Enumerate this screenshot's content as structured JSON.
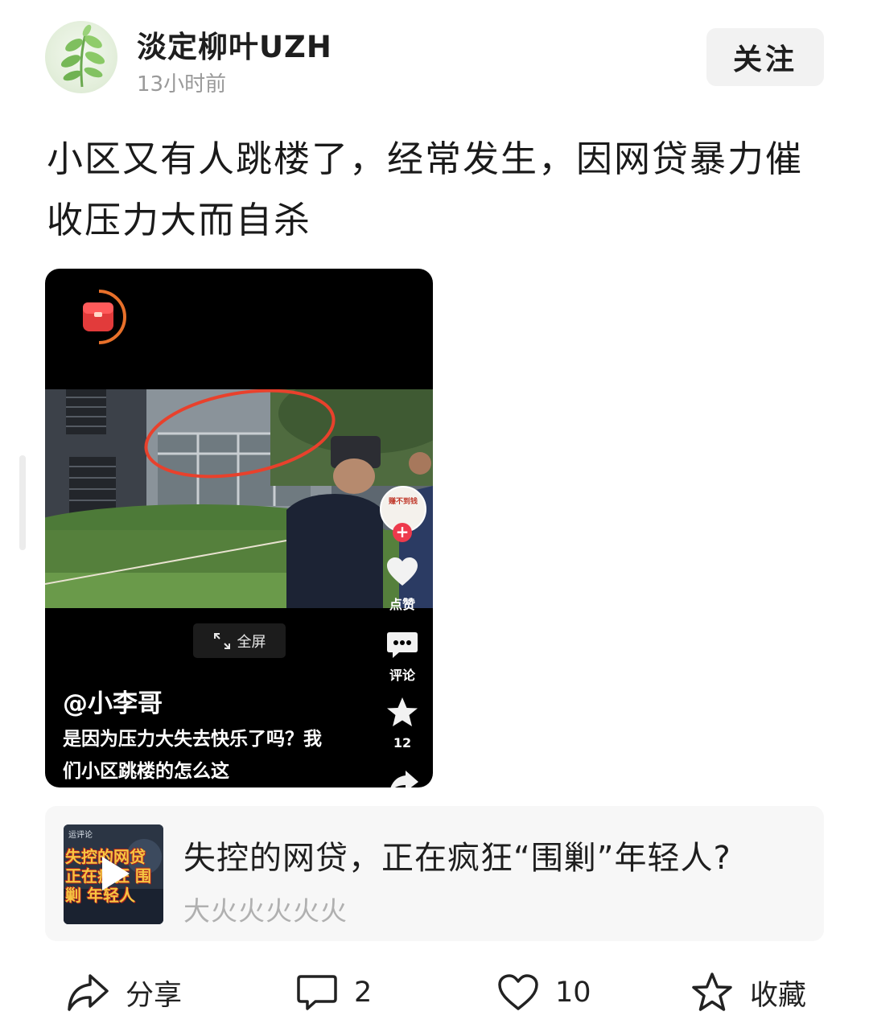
{
  "post": {
    "author": "淡定柳叶UZH",
    "time": "13小时前",
    "follow_label": "关注",
    "text": "小区又有人跳楼了，经常发生，因网贷暴力催收压力大而自杀"
  },
  "video": {
    "fullscreen_label": "全屏",
    "author": "@小李哥",
    "caption": "是因为压力大失去快乐了吗？我们小区跳楼的怎么这",
    "like_label": "点赞",
    "comment_label": "评论",
    "favorite_count": "12",
    "avatar_text": "赚不到钱"
  },
  "link_card": {
    "thumb_top_text": "运评论",
    "thumb_overlay_text": "失控的网贷 正在疯狂 围剿 年轻人",
    "title": "失控的网贷，正在疯狂“围剿”年轻人?",
    "subtitle": "大火火火火火"
  },
  "actions": {
    "share_label": "分享",
    "comment_count": "2",
    "like_count": "10",
    "favorite_label": "收藏"
  },
  "colors": {
    "accent_red": "#ee3a4c",
    "secondary_text": "#9a9a9a",
    "card_bg": "#f7f7f7"
  }
}
